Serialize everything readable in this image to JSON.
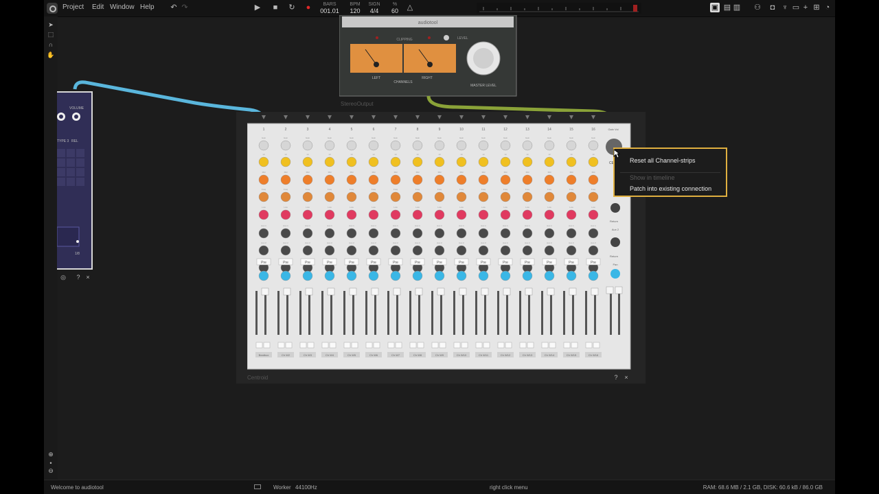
{
  "menu": [
    "Project",
    "Edit",
    "Window",
    "Help"
  ],
  "transport": {
    "bars_label": "BARS",
    "bars_value": "001.01",
    "bpm_label": "BPM",
    "bpm_value": "120",
    "sign_label": "SIGN",
    "sign_value": "4/4",
    "swing_label": "%",
    "swing_value": "60"
  },
  "stereo_output": {
    "title": "audiotool",
    "clipping": "CLIPPING",
    "level": "LEVEL",
    "left": "LEFT",
    "right": "RIGHT",
    "channels": "CHANNELS",
    "master": "MASTER LEVEL",
    "name": "StereoOutput"
  },
  "left_device": {
    "labels": [
      "VOLUME",
      "TYPE 3",
      "REL"
    ],
    "value": "1/8"
  },
  "mixer": {
    "name": "Centroid",
    "channel_numbers": [
      "1",
      "2",
      "3",
      "4",
      "5",
      "6",
      "7",
      "8",
      "9",
      "10",
      "11",
      "12",
      "13",
      "14",
      "15",
      "16"
    ],
    "master_label": "Gain Vol",
    "knob_rows": [
      "Gain",
      "Hi",
      "Mid",
      "Freq",
      "Low",
      "Aux 1",
      "Aux 2",
      "Aux 3"
    ],
    "pre_label": "Pre",
    "aux_return_1": "Return",
    "aux_return_2": "Return",
    "aux_label": "Aux 2",
    "pan_label": "Pan",
    "channel_names": [
      "Beatbox",
      "Ch W2",
      "Ch W3",
      "Ch W4",
      "Ch W5",
      "Ch W6",
      "Ch W7",
      "Ch W8",
      "Ch W9",
      "Ch W10",
      "Ch W11",
      "Ch W12",
      "Ch W13",
      "Ch W14",
      "Ch W15",
      "Ch W16"
    ],
    "center_label": "CEN",
    "colors": {
      "hi": "#f0c020",
      "mid": "#ee7e2a",
      "freq": "#e0883a",
      "low": "#e03a60",
      "pan": "#3ab7e6",
      "gain": "#d6d6d6",
      "aux": "#4a4a4a"
    }
  },
  "context_menu": [
    {
      "label": "Reset all Channel-strips",
      "enabled": true
    },
    {
      "label": "Show in timeline",
      "enabled": false
    },
    {
      "label": "Patch into existing connection",
      "enabled": true
    }
  ],
  "status": {
    "welcome": "Welcome to audiotool",
    "worker": "Worker",
    "rate": "44100",
    "rate_unit": "Hz",
    "hint": "right click menu",
    "memory": "RAM: 68.6 MB / 2.1 GB, DISK: 60.6 kB / 86.0 GB"
  },
  "cables": {
    "blue": "#5ab6dc",
    "green": "#8aa238"
  }
}
